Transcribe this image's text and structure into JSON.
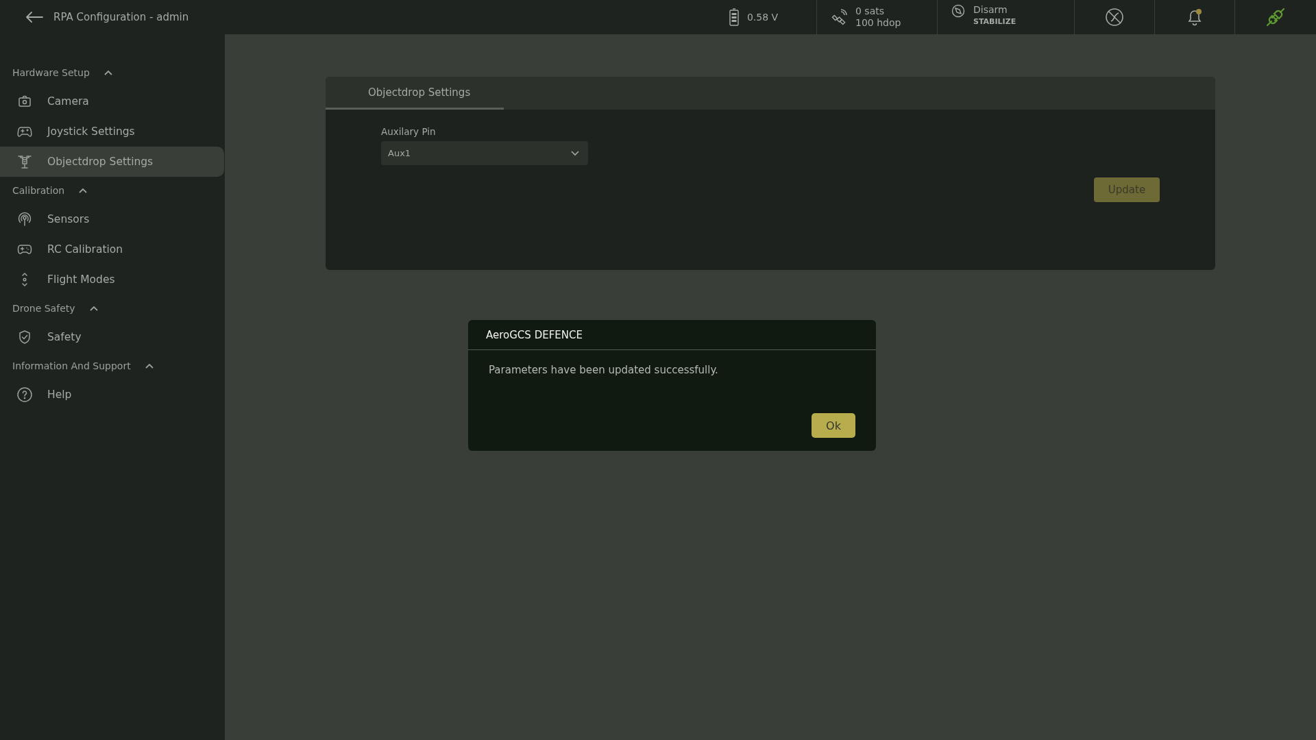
{
  "header": {
    "title": "RPA Configuration - admin"
  },
  "status": {
    "battery": "0.58 V",
    "gps": [
      "0 sats",
      "100 hdop"
    ],
    "arm_state": "Disarm",
    "flight_mode": "STABILIZE",
    "notification": true,
    "connected": true
  },
  "sidebar": {
    "sections": [
      {
        "title": "Hardware Setup",
        "expanded": true,
        "items": [
          {
            "label": "Camera",
            "selected": false
          },
          {
            "label": "Joystick Settings",
            "selected": false
          },
          {
            "label": "Objectdrop Settings",
            "selected": true
          }
        ]
      },
      {
        "title": "Calibration",
        "expanded": true,
        "items": [
          {
            "label": "Sensors",
            "selected": false
          },
          {
            "label": "RC Calibration",
            "selected": false
          },
          {
            "label": "Flight Modes",
            "selected": false
          }
        ]
      },
      {
        "title": "Drone Safety",
        "expanded": true,
        "items": [
          {
            "label": "Safety",
            "selected": false
          }
        ]
      },
      {
        "title": "Information And Support",
        "expanded": true,
        "items": [
          {
            "label": "Help",
            "selected": false
          }
        ]
      }
    ]
  },
  "tabs": [
    {
      "label": "Objectdrop Settings",
      "selected": true
    }
  ],
  "form": {
    "label": "Auxilary Pin",
    "value": "Aux1",
    "button": "Update"
  },
  "dialog": {
    "title": "AeroGCS DEFENCE",
    "message": "Parameters have been updated successfully.",
    "button": "Ok"
  }
}
